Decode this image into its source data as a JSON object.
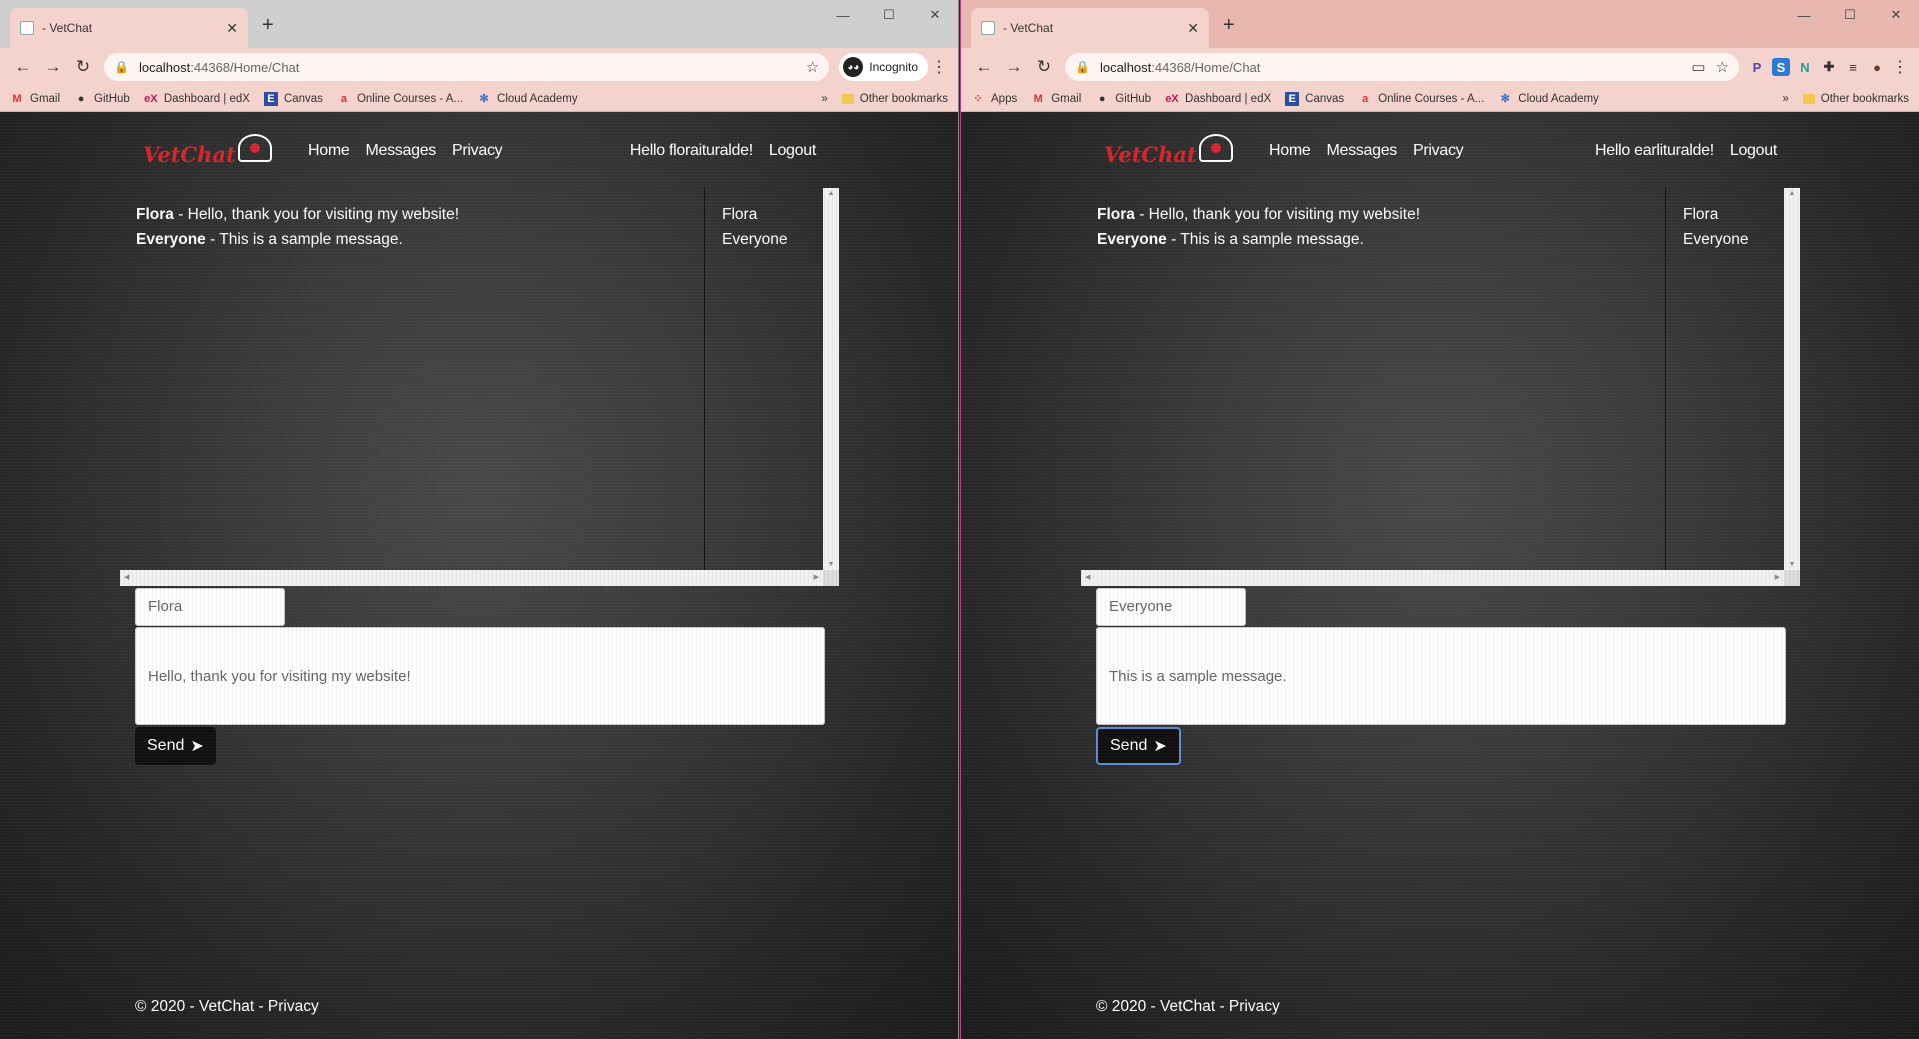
{
  "windows": [
    {
      "tab_title": "- VetChat",
      "url_host": "localhost",
      "url_path": ":44368/Home/Chat",
      "incognito_label": "Incognito",
      "bookmarks": [
        "Gmail",
        "GitHub",
        "Dashboard | edX",
        "Canvas",
        "Online Courses - A...",
        "Cloud Academy"
      ],
      "other_bookmarks": "Other bookmarks",
      "site": {
        "logo": "VetChat",
        "nav": [
          "Home",
          "Messages",
          "Privacy"
        ],
        "greeting": "Hello floraituralde!",
        "logout": "Logout",
        "messages": [
          {
            "author": "Flora",
            "text": " - Hello, thank you for visiting my website!"
          },
          {
            "author": "Everyone",
            "text": " - This is a sample message."
          }
        ],
        "users": [
          "Flora",
          "Everyone"
        ],
        "recipient_value": "Flora",
        "message_value": "Hello, thank you for visiting my website!",
        "send_label": "Send",
        "footer": "© 2020 - VetChat - Privacy"
      }
    },
    {
      "tab_title": "- VetChat",
      "url_host": "localhost",
      "url_path": ":44368/Home/Chat",
      "bookmarks": [
        "Apps",
        "Gmail",
        "GitHub",
        "Dashboard | edX",
        "Canvas",
        "Online Courses - A...",
        "Cloud Academy"
      ],
      "other_bookmarks": "Other bookmarks",
      "site": {
        "logo": "VetChat",
        "nav": [
          "Home",
          "Messages",
          "Privacy"
        ],
        "greeting": "Hello earlituralde!",
        "logout": "Logout",
        "messages": [
          {
            "author": "Flora",
            "text": " - Hello, thank you for visiting my website!"
          },
          {
            "author": "Everyone",
            "text": " - This is a sample message."
          }
        ],
        "users": [
          "Flora",
          "Everyone"
        ],
        "recipient_value": "Everyone",
        "message_value": "This is a sample message.",
        "send_label": "Send",
        "footer": "© 2020 - VetChat - Privacy"
      }
    }
  ],
  "colors": {
    "brand_red": "#d9252a",
    "chrome_tab_pink": "#f5d3cd",
    "send_focus_outline": "#5b8ed6"
  }
}
